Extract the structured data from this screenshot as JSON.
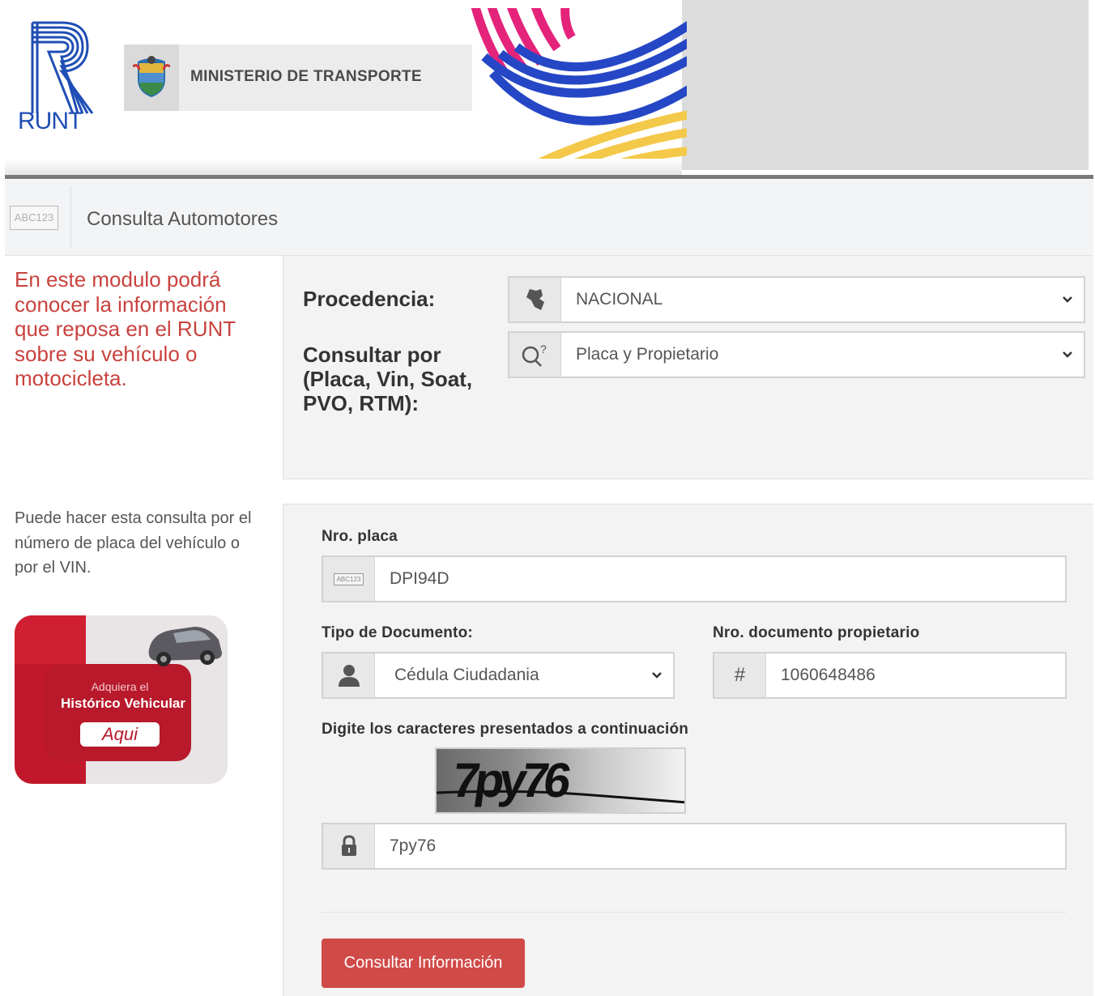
{
  "header": {
    "brand": "RUNT",
    "ministry": "MINISTERIO DE TRANSPORTE"
  },
  "titlebar": {
    "icon_text": "ABC123",
    "title": "Consulta Automotores"
  },
  "left": {
    "intro": "En este modulo podrá conocer la información que reposa en el RUNT sobre su vehículo o motocicleta.",
    "help": "Puede hacer esta consulta por el número de placa del vehículo o por el VIN.",
    "promo": {
      "line1": "Adquiera el",
      "line2": "Histórico Vehicular",
      "button": "Aqui"
    }
  },
  "form": {
    "procedencia": {
      "label": "Procedencia:",
      "value": "NACIONAL"
    },
    "consultar_por": {
      "label": "Consultar por (Placa, Vin, Soat, PVO, RTM):",
      "value": "Placa y Propietario"
    },
    "placa": {
      "label": "Nro. placa",
      "icon_text": "ABC123",
      "value": "DPI94D"
    },
    "tipo_documento": {
      "label": "Tipo de Documento:",
      "value": "Cédula Ciudadania"
    },
    "nro_documento": {
      "label": "Nro. documento propietario",
      "icon": "#",
      "value": "1060648486"
    },
    "captcha": {
      "label": "Digite los caracteres presentados a continuación",
      "image_text": "7py76",
      "value": "7py76"
    },
    "submit_label": "Consultar Información"
  },
  "colors": {
    "brand_blue": "#1f4eb4",
    "accent_red": "#d04a48",
    "intro_red": "#c9423e"
  }
}
